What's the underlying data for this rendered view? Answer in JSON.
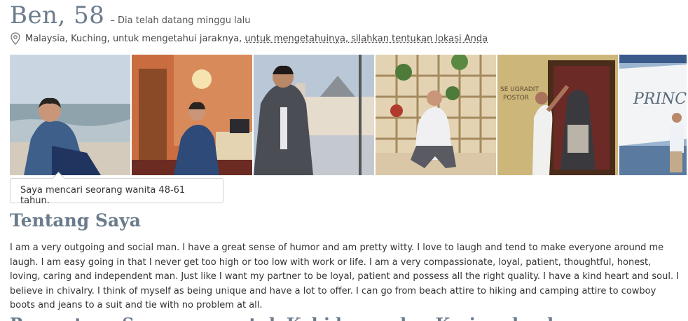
{
  "profile": {
    "name_age": "Ben, 58",
    "last_seen": "– Dia telah datang minggu lalu",
    "location_text": "Malaysia, Kuching, untuk mengetahui jaraknya,",
    "location_link": "untuk mengetahuinya, silahkan tentukan lokasi Anda"
  },
  "photos": [
    {
      "icon": "beach-photo"
    },
    {
      "icon": "office-photo"
    },
    {
      "icon": "building-photo"
    },
    {
      "icon": "garden-photo"
    },
    {
      "icon": "painting-photo"
    },
    {
      "icon": "ship-photo"
    }
  ],
  "seeking": "Saya mencari seorang wanita 48-61 tahun.",
  "about": {
    "title": "Tentang Saya",
    "text": "I am a very outgoing and social man. I have a great sense of humor and am pretty witty. I love to laugh and tend to make everyone around me laugh. I am easy going in that I never get too high or too low with work or life. I am a very compassionate, loyal, patient, thoughtful, honest, loving, caring and independent man. Just like I want my partner to be loyal, patient and possess all the right quality. I have a kind heart and soul. I believe in chivalry. I think of myself as being unique and have a lot to offer. I can go from beach attire to hiking and camping attire to cowboy boots and jeans to a suit and tie with no problem at all."
  },
  "next_section": "Pernyataan Sempurna untuk Kehidupan dan Kerja sebuah..."
}
